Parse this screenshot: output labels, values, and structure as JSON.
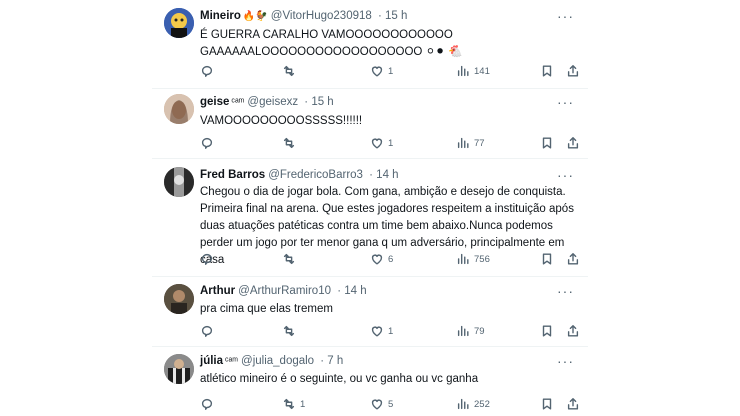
{
  "tweets": [
    {
      "name": "Mineiro",
      "handle": "@VitorHugo230918",
      "time": "· 15 h",
      "emoji": "🔥🐓",
      "text": "É GUERRA CARALHO VAMOOOOOOOOOOOO GAAAAAALOOOOOOOOOOOOOOOOOO ⚪⚫ 🐔",
      "replies": "",
      "retweets": "",
      "likes": "1",
      "views": "141",
      "avatar_color": "#3a5fb0"
    },
    {
      "name": "geise",
      "handle": "@geisexz",
      "time": "· 15 h",
      "emoji": "ᶜᵃᵐ",
      "text": "VAMOOOOOOOOOSSSSS!!!!!!",
      "replies": "",
      "retweets": "",
      "likes": "1",
      "views": "77",
      "avatar_color": "#c9a48a"
    },
    {
      "name": "Fred Barros",
      "handle": "@FredericoBarro3",
      "time": "· 14 h",
      "emoji": "",
      "text": "Chegou o dia de jogar bola. Com gana, ambição e desejo de conquista.\nPrimeira final na arena. Que estes jogadores respeitem a instituição após duas atuações patéticas contra um time bem abaixo.Nunca podemos perder um jogo por ter menor gana q um adversário, principalmente em casa",
      "replies": "",
      "retweets": "",
      "likes": "6",
      "views": "756",
      "avatar_color": "#6b6b6b"
    },
    {
      "name": "Arthur",
      "handle": "@ArthurRamiro10",
      "time": "· 14 h",
      "emoji": "",
      "text": "pra cima que elas tremem",
      "replies": "",
      "retweets": "",
      "likes": "1",
      "views": "79",
      "avatar_color": "#4a4236"
    },
    {
      "name": "júlia",
      "handle": "@julia_dogalo",
      "time": "· 7 h",
      "emoji": "ᶜᵃᵐ",
      "text": "atlético mineiro é o seguinte, ou vc ganha ou vc ganha",
      "replies": "",
      "retweets": "1",
      "likes": "5",
      "views": "252",
      "avatar_color": "#7c7c7c"
    }
  ],
  "icons": {
    "reply": "reply-icon",
    "retweet": "retweet-icon",
    "like": "heart-icon",
    "views": "views-icon",
    "bookmark": "bookmark-icon",
    "share": "share-icon",
    "more": "more-icon"
  }
}
